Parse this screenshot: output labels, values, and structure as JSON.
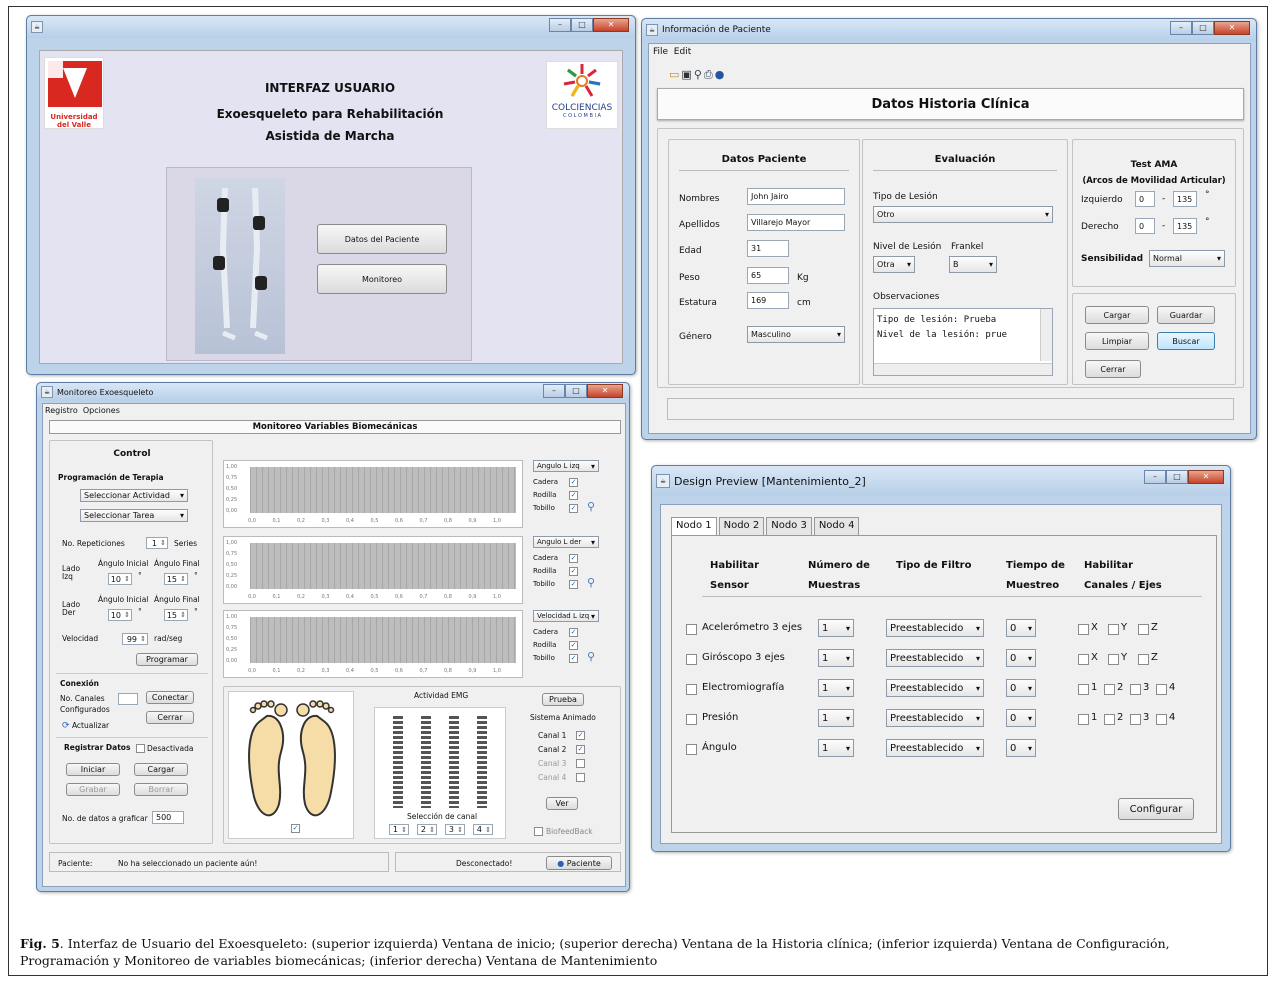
{
  "w1": {
    "title": "",
    "heading1": "INTERFAZ USUARIO",
    "heading2": "Exoesqueleto para Rehabilitación",
    "heading3": "Asistida de Marcha",
    "logo_left": "Universidad del Valle",
    "logo_right": "COLCIENCIAS",
    "logo_right_sub": "C O L O M B I A",
    "btn_datos": "Datos del Paciente",
    "btn_monitoreo": "Monitoreo"
  },
  "w2": {
    "title": "Información de Paciente",
    "menu": [
      "File",
      "Edit"
    ],
    "header": "Datos Historia Clínica",
    "datos": {
      "title": "Datos Paciente",
      "fields": [
        {
          "label": "Nombres",
          "value": "John Jairo"
        },
        {
          "label": "Apellidos",
          "value": "Villarejo Mayor"
        },
        {
          "label": "Edad",
          "value": "31"
        },
        {
          "label": "Peso",
          "value": "65",
          "unit": "Kg"
        },
        {
          "label": "Estatura",
          "value": "169",
          "unit": "cm"
        },
        {
          "label": "Género",
          "value": "Masculino"
        }
      ]
    },
    "eval": {
      "title": "Evaluación",
      "tipo_label": "Tipo de Lesión",
      "tipo_value": "Otro",
      "nivel_label": "Nivel de Lesión",
      "nivel_value": "Otra",
      "frankel_label": "Frankel",
      "frankel_value": "B",
      "obs_label": "Observaciones",
      "obs_line1": "Tipo de lesión: Prueba",
      "obs_line2": "Nivel de la lesión: prue"
    },
    "ama": {
      "title": "Test AMA",
      "subtitle": "(Arcos de Movilidad Articular)",
      "izq_label": "Izquierdo",
      "izq_min": "0",
      "izq_max": "135",
      "der_label": "Derecho",
      "der_min": "0",
      "der_max": "135",
      "deg": "°",
      "dash": "-",
      "sens_label": "Sensibilidad",
      "sens_value": "Normal"
    },
    "buttons": {
      "cargar": "Cargar",
      "guardar": "Guardar",
      "limpiar": "Limpiar",
      "buscar": "Buscar",
      "cerrar": "Cerrar"
    }
  },
  "w3": {
    "title": "Monitoreo Exoesqueleto",
    "menu": [
      "Registro",
      "Opciones"
    ],
    "header": "Monitoreo Variables Biomecánicas",
    "control": {
      "title": "Control",
      "prog": "Programación de Terapia",
      "actividad": "Seleccionar Actividad",
      "tarea": "Seleccionar Tarea",
      "rep_label": "No. Repeticiones",
      "rep_value": "1",
      "series": "Series",
      "lado_izq": "Lado Izq",
      "lado_der": "Lado Der",
      "ang_ini": "Ángulo Inicial",
      "ang_fin": "Ángulo Final",
      "izq_ini": "10",
      "izq_fin": "15",
      "der_ini": "10",
      "der_fin": "15",
      "deg": "°",
      "vel_label": "Velocidad",
      "vel_value": "99",
      "vel_unit": "rad/seg",
      "programar": "Programar",
      "conexion": "Conexión",
      "canales": "No. Canales Configurados",
      "actualizar": "Actualizar",
      "conectar": "Conectar",
      "cerrar": "Cerrar",
      "registrar": "Registrar Datos",
      "desactivada": "Desactivada",
      "iniciar": "Iniciar",
      "cargar": "Cargar",
      "grabar": "Grabar",
      "borrar": "Borrar",
      "graficar_label": "No. de datos a graficar",
      "graficar_value": "500"
    },
    "charts": [
      {
        "select": "Angulo L izq",
        "checks": [
          "Cadera",
          "Rodilla",
          "Tobillo"
        ]
      },
      {
        "select": "Angulo L der",
        "checks": [
          "Cadera",
          "Rodilla",
          "Tobillo"
        ]
      },
      {
        "select": "Velocidad L izq",
        "checks": [
          "Cadera",
          "Rodilla",
          "Tobillo"
        ]
      }
    ],
    "yticks": [
      "1,00",
      "0,75",
      "0,50",
      "0,25",
      "0,00"
    ],
    "xticks": [
      "0,0",
      "0,1",
      "0,2",
      "0,3",
      "0,4",
      "0,5",
      "0,6",
      "0,7",
      "0,8",
      "0,9",
      "1,0"
    ],
    "emg": {
      "title": "Actividad EMG",
      "seleccion": "Selección de canal",
      "canal_values": [
        "1",
        "2",
        "3",
        "4"
      ],
      "prueba": "Prueba",
      "sistema": "Sistema Animado",
      "canales": [
        "Canal 1",
        "Canal 2",
        "Canal 3",
        "Canal 4"
      ],
      "ver": "Ver",
      "biofeed": "BiofeedBack"
    },
    "status": {
      "paciente_label": "Paciente:",
      "paciente_msg": "No ha seleccionado un paciente aún!",
      "conn": "Desconectado!",
      "btn": "Paciente"
    }
  },
  "w4": {
    "title": "Design Preview [Mantenimiento_2]",
    "tabs": [
      "Nodo 1",
      "Nodo 2",
      "Nodo 3",
      "Nodo 4"
    ],
    "cols": [
      "Habilitar Sensor",
      "Número de Muestras",
      "Tipo de Filtro",
      "Tiempo de Muestreo",
      "Habilitar Canales / Ejes"
    ],
    "rows": [
      {
        "sensor": "Acelerómetro 3 ejes",
        "muestras": "1",
        "filtro": "Preestablecido",
        "tiempo": "0",
        "canales": [
          "X",
          "Y",
          "Z"
        ]
      },
      {
        "sensor": "Giróscopo 3 ejes",
        "muestras": "1",
        "filtro": "Preestablecido",
        "tiempo": "0",
        "canales": [
          "X",
          "Y",
          "Z"
        ]
      },
      {
        "sensor": "Electromiografía",
        "muestras": "1",
        "filtro": "Preestablecido",
        "tiempo": "0",
        "canales": [
          "1",
          "2",
          "3",
          "4"
        ]
      },
      {
        "sensor": "Presión",
        "muestras": "1",
        "filtro": "Preestablecido",
        "tiempo": "0",
        "canales": [
          "1",
          "2",
          "3",
          "4"
        ]
      },
      {
        "sensor": "Ángulo",
        "muestras": "1",
        "filtro": "Preestablecido",
        "tiempo": "0",
        "canales": []
      }
    ],
    "configurar": "Configurar"
  },
  "caption": {
    "lead": "Fig.  5",
    "text": ". Interfaz de Usuario del Exoesqueleto: (superior izquierda) Ventana de inicio; (superior derecha) Ventana de la Historia clínica; (inferior izquierda) Ventana de Configuración, Programación y Monitoreo de variables biomecánicas; (inferior derecha) Ventana de Mantenimiento"
  }
}
